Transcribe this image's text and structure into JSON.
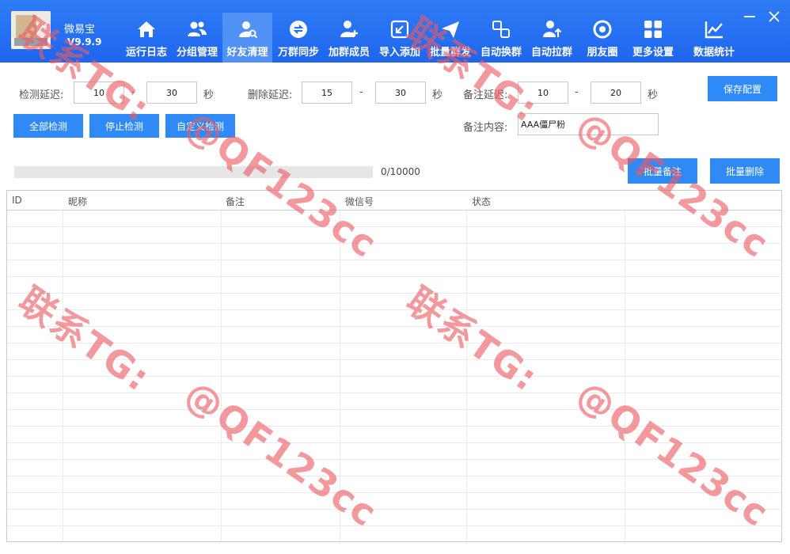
{
  "app": {
    "name": "微易宝",
    "version": "V9.9.9"
  },
  "nav": [
    {
      "id": "log",
      "label": "运行日志",
      "icon": "home-icon"
    },
    {
      "id": "group",
      "label": "分组管理",
      "icon": "users-icon"
    },
    {
      "id": "clean",
      "label": "好友清理",
      "icon": "user-search-icon",
      "active": true
    },
    {
      "id": "sync",
      "label": "万群同步",
      "icon": "sync-icon"
    },
    {
      "id": "add-member",
      "label": "加群成员",
      "icon": "user-add-icon"
    },
    {
      "id": "import",
      "label": "导入添加",
      "icon": "import-icon"
    },
    {
      "id": "mass-send",
      "label": "批量群发",
      "icon": "send-icon"
    },
    {
      "id": "auto-swap",
      "label": "自动换群",
      "icon": "swap-icon"
    },
    {
      "id": "auto-pull",
      "label": "自动拉群",
      "icon": "user-up-icon"
    },
    {
      "id": "moments",
      "label": "朋友圈",
      "icon": "aperture-icon"
    },
    {
      "id": "settings",
      "label": "更多设置",
      "icon": "grid-icon"
    },
    {
      "id": "stats",
      "label": "数据统计",
      "icon": "chart-line-icon"
    }
  ],
  "form": {
    "detect_delay_label": "检测延迟:",
    "detect_min": "10",
    "detect_max": "30",
    "delete_delay_label": "删除延迟:",
    "delete_min": "15",
    "delete_max": "30",
    "remark_delay_label": "备注延迟:",
    "remark_min": "10",
    "remark_max": "20",
    "dash": "-",
    "sec": "秒",
    "remark_content_label": "备注内容:",
    "remark_content": "AAA僵尸粉"
  },
  "buttons": {
    "save_config": "保存配置",
    "detect_all": "全部检测",
    "stop_detect": "停止检测",
    "custom_detect": "自定义检测",
    "batch_remark": "批量备注",
    "batch_delete": "批量删除"
  },
  "progress": {
    "text": "0/10000",
    "done": 0,
    "total": 10000
  },
  "table": {
    "columns": [
      "ID",
      "昵称",
      "备注",
      "微信号",
      "状态"
    ],
    "rows": []
  },
  "watermark": {
    "line1": "联系TG:",
    "line2": "@QF123cc"
  },
  "colors": {
    "header": "#1e66ee",
    "active_tab": "#5091f6",
    "button": "#2f8af7",
    "watermark": "#ec5a62"
  }
}
